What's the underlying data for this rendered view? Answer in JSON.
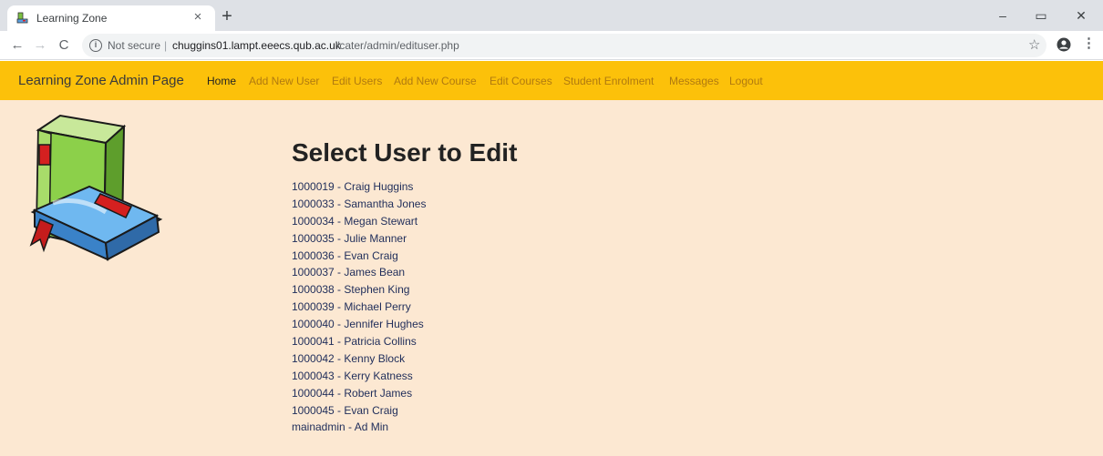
{
  "browser": {
    "tab_title": "Learning Zone",
    "close_glyph": "×",
    "newtab_glyph": "+",
    "window": {
      "minimize": "–",
      "maximize": "▭",
      "close": "✕"
    },
    "nav": {
      "back": "←",
      "forward": "→",
      "reload": "C"
    },
    "address": {
      "security_label": "Not secure",
      "separator": "|",
      "host": "chuggins01.lampt.eeecs.qub.ac.uk",
      "path": "/cater/admin/edituser.php"
    },
    "star_glyph": "☆",
    "menu_glyph": "⋮"
  },
  "navbar": {
    "brand": "Learning Zone Admin Page",
    "links": [
      {
        "label": "Home",
        "active": true
      },
      {
        "label": "Add New User",
        "active": false
      },
      {
        "label": "Edit Users",
        "active": false
      },
      {
        "label": "Add New Course",
        "active": false
      },
      {
        "label": "Edit Courses",
        "active": false
      },
      {
        "label": "Student Enrolment",
        "active": false
      },
      {
        "label": "Messages",
        "active": false
      },
      {
        "label": "Logout",
        "active": false
      }
    ]
  },
  "main": {
    "heading": "Select User to Edit",
    "users": [
      "1000019 - Craig Huggins",
      "1000033 - Samantha Jones",
      "1000034 - Megan Stewart",
      "1000035 - Julie Manner",
      "1000036 - Evan Craig",
      "1000037 - James Bean",
      "1000038 - Stephen King",
      "1000039 - Michael Perry",
      "1000040 - Jennifer Hughes",
      "1000041 - Patricia Collins",
      "1000042 - Kenny Block",
      "1000043 - Kerry Katness",
      "1000044 - Robert James",
      "1000045 - Evan Craig",
      "mainadmin - Ad Min"
    ]
  },
  "colors": {
    "navbar_bg": "#fcc10a",
    "page_bg": "#fce8d2",
    "nav_link": "#b07a10",
    "nav_link_active": "#222222",
    "list_text": "#1f2d5a"
  },
  "icons": {
    "favicon": "books-icon",
    "logo": "book-stack-icon"
  }
}
